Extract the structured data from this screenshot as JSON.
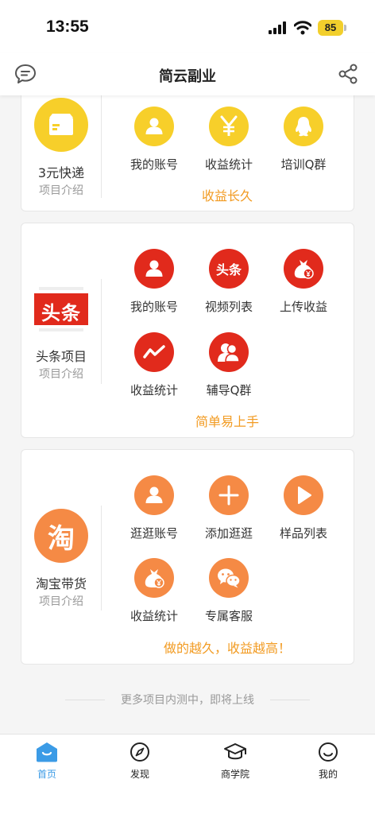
{
  "status_bar": {
    "time": "13:55",
    "battery": "85"
  },
  "header": {
    "title": "简云副业"
  },
  "cards": {
    "express": {
      "name": "3元快递",
      "subtitle": "项目介绍",
      "items": [
        "我的账号",
        "收益统计",
        "培训Q群"
      ],
      "tagline": "收益长久"
    },
    "toutiao": {
      "logo_text": "头条",
      "name": "头条项目",
      "subtitle": "项目介绍",
      "items": [
        "我的账号",
        "视频列表",
        "上传收益",
        "收益统计",
        "辅导Q群"
      ],
      "tagline": "简单易上手"
    },
    "taobao": {
      "logo_text": "淘",
      "name": "淘宝带货",
      "subtitle": "项目介绍",
      "items": [
        "逛逛账号",
        "添加逛逛",
        "样品列表",
        "收益统计",
        "专属客服"
      ],
      "tagline": "做的越久，收益越高！"
    }
  },
  "footer_note": "更多项目内测中，即将上线",
  "tabbar": {
    "items": [
      "首页",
      "发现",
      "商学院",
      "我的"
    ],
    "active": "首页"
  },
  "colors": {
    "accent_yellow": "#f7cf2a",
    "accent_red": "#e12a1c",
    "accent_orange": "#f58a45",
    "tagline": "#f29b22",
    "tab_active": "#3b9be6"
  }
}
